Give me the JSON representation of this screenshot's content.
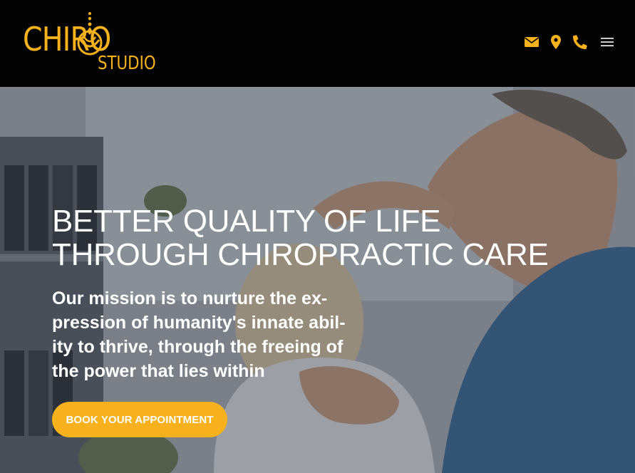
{
  "brand": {
    "name_main": "CHIRO",
    "name_sub": "STUDIO",
    "color": "#f6b11c"
  },
  "header": {
    "icons": [
      "envelope-icon",
      "map-marker-icon",
      "phone-icon",
      "hamburger-menu-icon"
    ]
  },
  "hero": {
    "title_lines": [
      "BETTER QUALITY OF LIFE",
      "THROUGH CHIROPRACTIC CARE"
    ],
    "subtitle_lines": [
      "Our mission is to nurture the ex-",
      "pression of humanity's innate abil-",
      "ity to thrive, through the freeing of",
      "the power that lies within"
    ],
    "cta_label": "BOOK YOUR APPOINTMENT"
  }
}
